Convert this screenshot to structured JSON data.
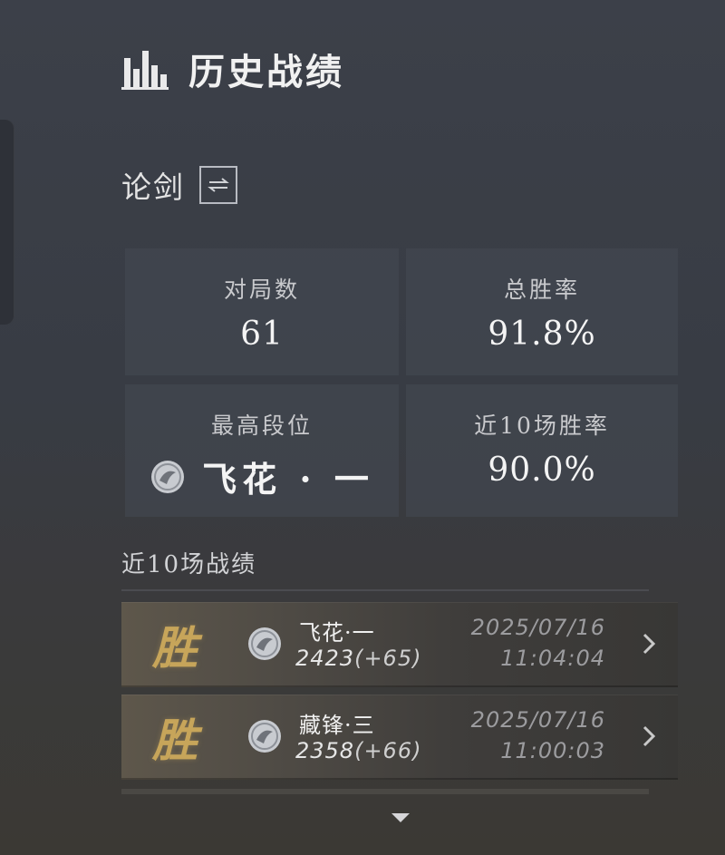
{
  "header": {
    "title": "历史战绩",
    "icon": "bar-chart-icon"
  },
  "mode": {
    "label": "论剑",
    "switch_icon": "switch-arrows-icon"
  },
  "stats": {
    "matches": {
      "label": "对局数",
      "value": "61"
    },
    "win_rate": {
      "label": "总胜率",
      "value": "91.8%"
    },
    "highest_rank": {
      "label": "最高段位",
      "value": "飞花 · 一",
      "icon": "rank-emblem-icon"
    },
    "recent_win_rate": {
      "label": "近10场胜率",
      "value": "90.0%"
    }
  },
  "recent": {
    "title": "近10场战绩",
    "matches": [
      {
        "result": "胜",
        "rank": "飞花·一",
        "score": "2423",
        "delta": "(+65)",
        "date": "2025/07/16",
        "time": "11:04:04"
      },
      {
        "result": "胜",
        "rank": "藏锋·三",
        "score": "2358",
        "delta": "(+66)",
        "date": "2025/07/16",
        "time": "11:00:03"
      }
    ]
  },
  "colors": {
    "win_gold": "#c7a55a",
    "background": "#3c4049"
  }
}
